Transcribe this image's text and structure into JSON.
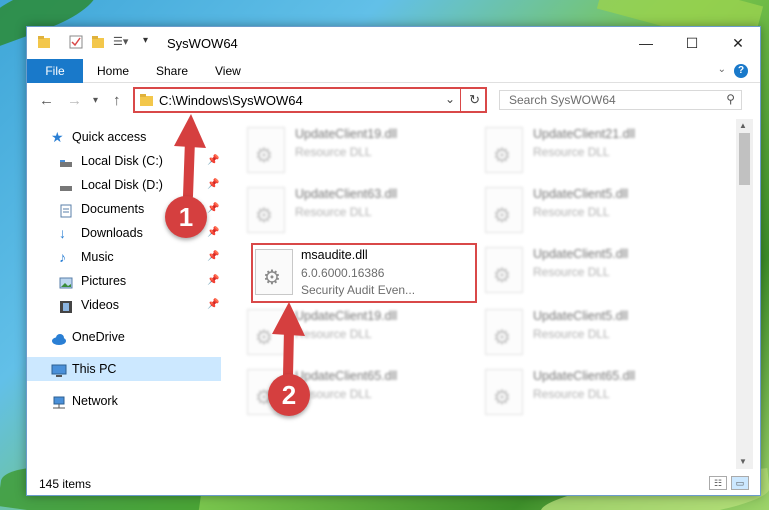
{
  "window": {
    "title": "SysWOW64"
  },
  "ribbon": {
    "tabs": [
      "File",
      "Home",
      "Share",
      "View"
    ],
    "help": "?"
  },
  "address": {
    "path": "C:\\Windows\\SysWOW64"
  },
  "search": {
    "placeholder": "Search SysWOW64"
  },
  "sidebar": {
    "items": [
      {
        "label": "Quick access",
        "pinned": false
      },
      {
        "label": "Local Disk (C:)",
        "pinned": true
      },
      {
        "label": "Local Disk (D:)",
        "pinned": true
      },
      {
        "label": "Documents",
        "pinned": true
      },
      {
        "label": "Downloads",
        "pinned": true
      },
      {
        "label": "Music",
        "pinned": true
      },
      {
        "label": "Pictures",
        "pinned": true
      },
      {
        "label": "Videos",
        "pinned": true
      },
      {
        "label": "OneDrive",
        "pinned": false
      },
      {
        "label": "This PC",
        "pinned": false,
        "selected": true
      },
      {
        "label": "Network",
        "pinned": false
      }
    ]
  },
  "files": [
    {
      "name": "UpdateClient19.dll",
      "desc": "Resource DLL"
    },
    {
      "name": "UpdateClient21.dll",
      "desc": "Resource DLL"
    },
    {
      "name": "UpdateClient63.dll",
      "desc": "Resource DLL"
    },
    {
      "name": "UpdateClient5.dll",
      "desc": "Resource DLL"
    },
    {
      "name": "msaudite.dll",
      "version": "6.0.6000.16386",
      "desc": "Security Audit Even..."
    },
    {
      "name": "UpdateClient5.dll",
      "desc": "Resource DLL"
    },
    {
      "name": "UpdateClient19.dll",
      "desc": "Resource DLL"
    },
    {
      "name": "UpdateClient5.dll",
      "desc": "Resource DLL"
    },
    {
      "name": "UpdateClient65.dll",
      "desc": "Resource DLL"
    },
    {
      "name": "UpdateClient65.dll",
      "desc": "Resource DLL"
    }
  ],
  "status": {
    "item_count": "145 items"
  },
  "annotations": {
    "step1": "1",
    "step2": "2",
    "accent": "#d53f3f"
  }
}
